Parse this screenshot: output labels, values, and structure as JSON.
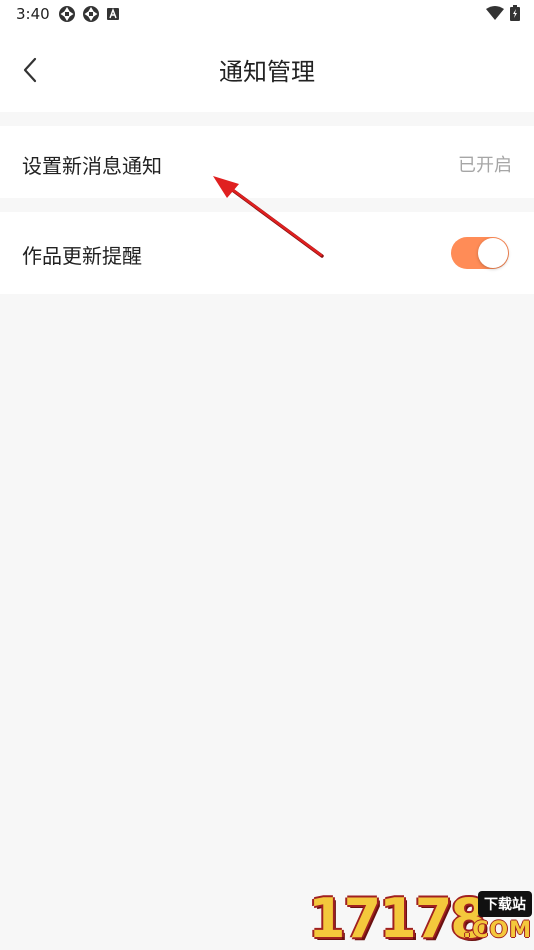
{
  "status_bar": {
    "time": "3:40",
    "left_icons": [
      "settings-gear-icon",
      "settings-gear-icon",
      "a-badge-icon"
    ],
    "right_icons": [
      "wifi-icon",
      "battery-charging-icon"
    ]
  },
  "header": {
    "back_icon": "chevron-left-icon",
    "title": "通知管理"
  },
  "settings": {
    "new_message_notification": {
      "label": "设置新消息通知",
      "value": "已开启"
    },
    "works_update_reminder": {
      "label": "作品更新提醒",
      "enabled": true,
      "toggle_color": "#ff8c57"
    }
  },
  "annotation": {
    "type": "arrow",
    "color": "#e02020",
    "points_to": "设置新消息通知"
  },
  "watermark": {
    "digits": "17178",
    "badge": "下载站",
    "domain": ".COM"
  }
}
